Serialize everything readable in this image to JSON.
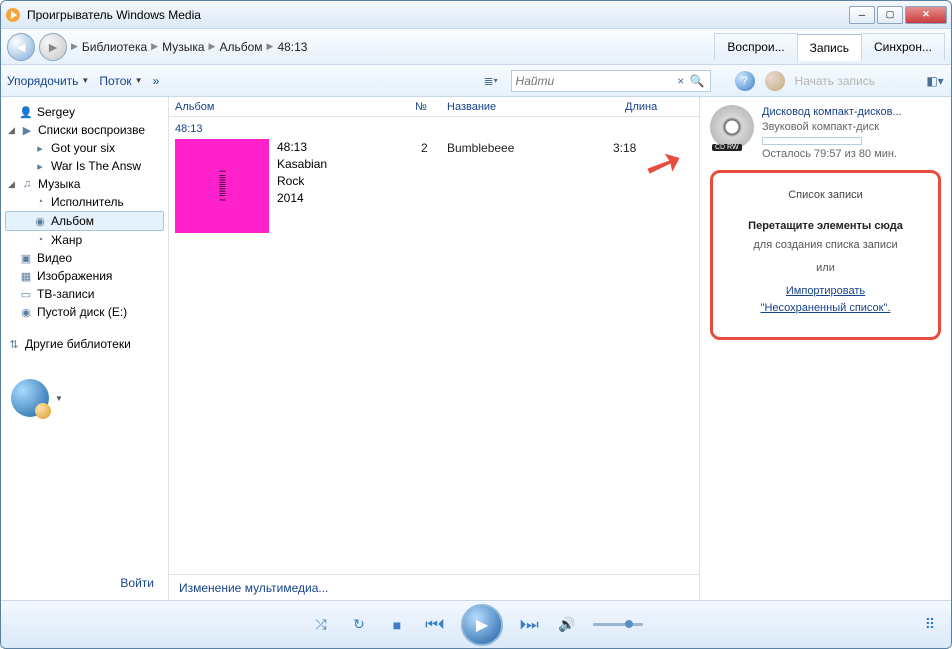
{
  "window": {
    "title": "Проигрыватель Windows Media"
  },
  "nav": {
    "breadcrumb": [
      "Библиотека",
      "Музыка",
      "Альбом",
      "48:13"
    ],
    "tabs": {
      "play": "Воспрои...",
      "burn": "Запись",
      "sync": "Синхрон..."
    }
  },
  "toolbar": {
    "organize": "Упорядочить",
    "stream": "Поток",
    "more": "»",
    "search_placeholder": "Найти",
    "burn_btn": "Начать запись"
  },
  "sidebar": {
    "user": "Sergey",
    "playlists": "Списки воспроизве",
    "pl_items": [
      "Got your six",
      "War Is The Answ"
    ],
    "music": "Музыка",
    "artist": "Исполнитель",
    "album": "Альбом",
    "genre": "Жанр",
    "video": "Видео",
    "pictures": "Изображения",
    "tv": "ТВ-записи",
    "blank_disc": "Пустой диск (E:)",
    "other_libs": "Другие библиотеки",
    "login": "Войти"
  },
  "columns": {
    "album": "Альбом",
    "num": "№",
    "title": "Название",
    "length": "Длина"
  },
  "album": {
    "header": "48:13",
    "name": "48:13",
    "artist": "Kasabian",
    "genre": "Rock",
    "year": "2014",
    "tracks": [
      {
        "num": "2",
        "title": "Bumblebeee",
        "length": "3:18"
      }
    ]
  },
  "status": "Изменение мультимедиа...",
  "drive": {
    "link": "Дисковод компакт-дисков...",
    "type": "Звуковой компакт-диск",
    "remaining": "Осталось 79:57 из 80 мин."
  },
  "burn": {
    "title": "Список записи",
    "drag": "Перетащите элементы сюда",
    "sub": "для создания списка записи",
    "or": "или",
    "import1": "Импортировать",
    "import2": "\"Несохраненный список\"."
  }
}
